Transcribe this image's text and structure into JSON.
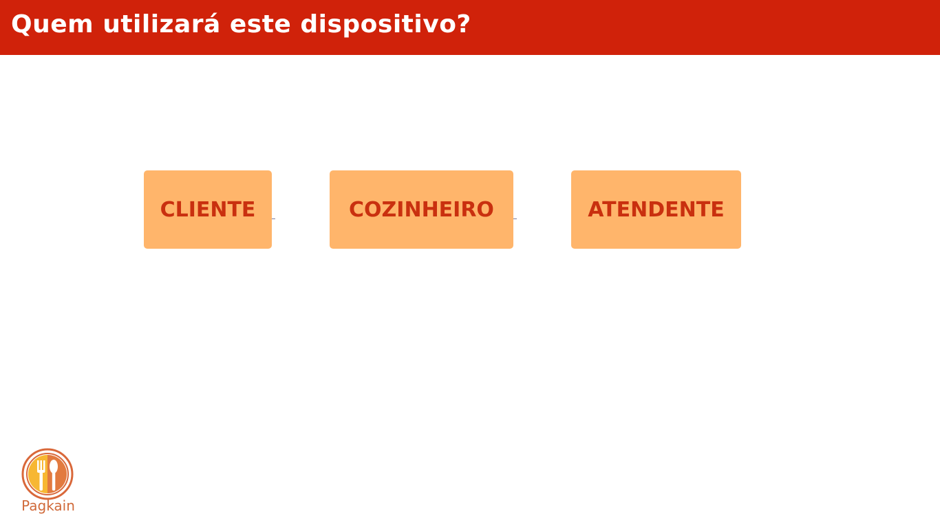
{
  "header": {
    "title": "Quem utilizará este dispositivo?"
  },
  "roles": [
    {
      "label": "CLIENTE"
    },
    {
      "label": "COZINHEIRO"
    },
    {
      "label": "ATENDENTE"
    }
  ],
  "logo": {
    "brand": "Pagkain",
    "icon": "fork-spoon-icon"
  },
  "colors": {
    "header_bg": "#d0220a",
    "button_bg": "#ffb56b",
    "button_text": "#c9300f"
  }
}
